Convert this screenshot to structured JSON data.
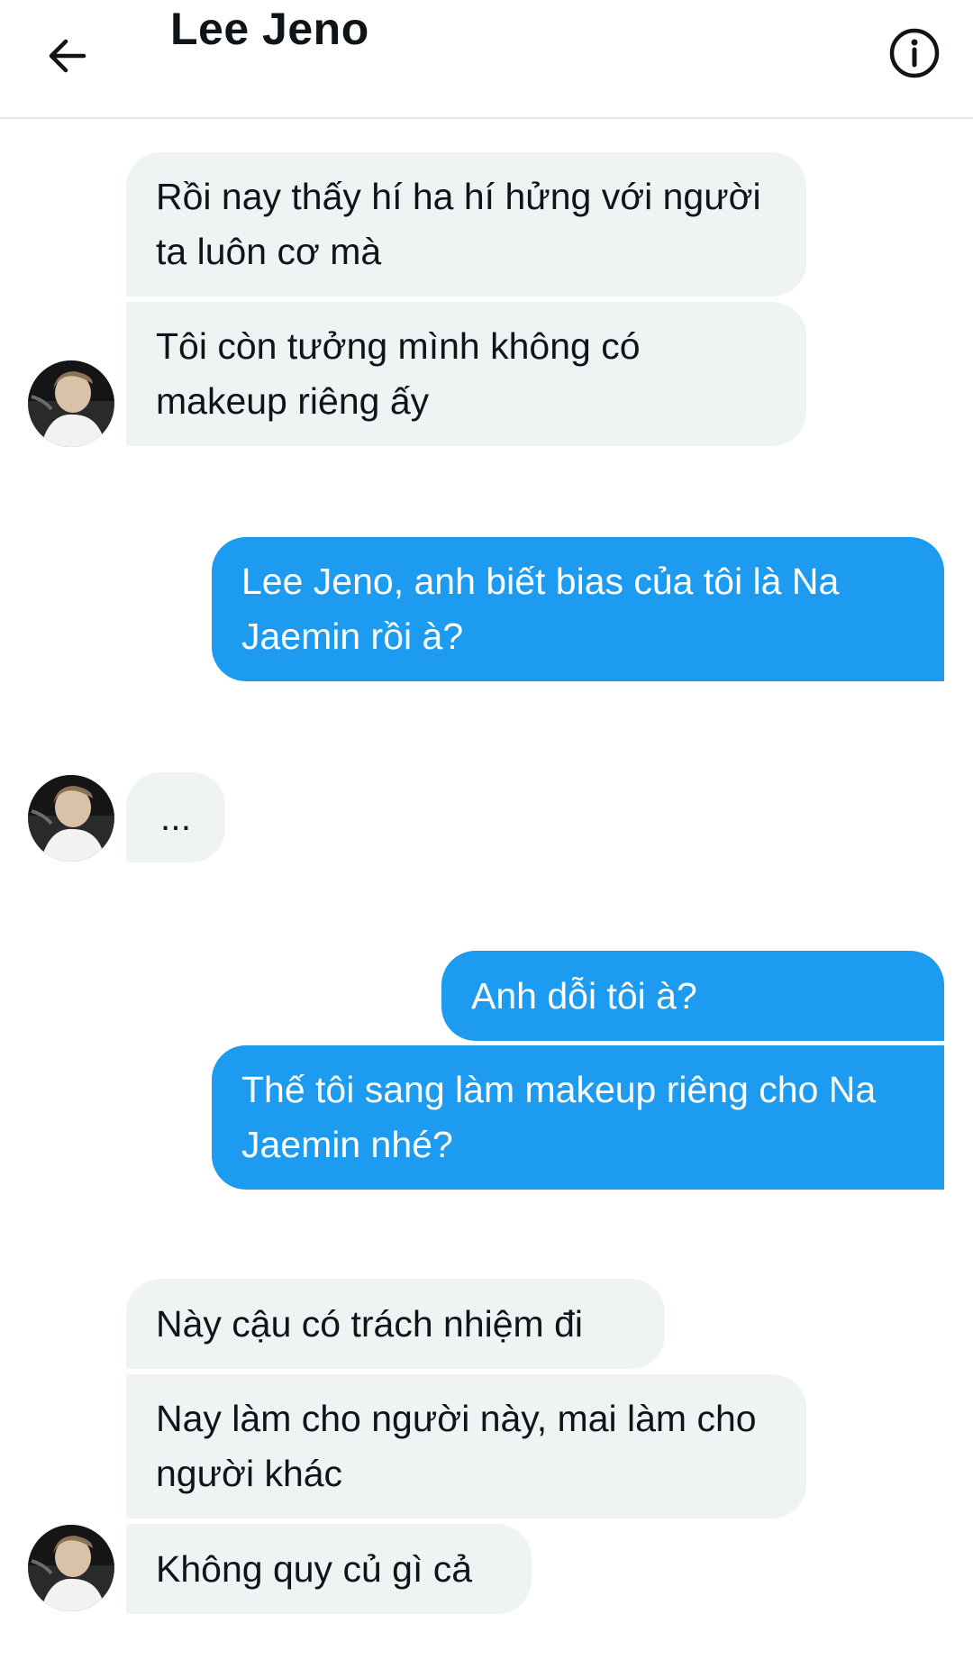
{
  "header": {
    "title": "Lee Jeno",
    "back_icon": "arrow-left-icon",
    "info_icon": "info-circle-icon"
  },
  "messages": [
    {
      "sender": "contact",
      "text": "Rồi nay thấy hí ha hí hửng với người ta luôn cơ mà"
    },
    {
      "sender": "contact",
      "text": "Tôi còn tưởng mình không có makeup riêng ấy"
    },
    {
      "sender": "me",
      "text": "Lee Jeno, anh biết bias của tôi là Na Jaemin rồi à?"
    },
    {
      "sender": "contact",
      "text": "..."
    },
    {
      "sender": "me",
      "text": "Anh dỗi tôi à?"
    },
    {
      "sender": "me",
      "text": "Thế tôi sang làm makeup riêng cho Na Jaemin nhé?"
    },
    {
      "sender": "contact",
      "text": "Này cậu có trách nhiệm đi"
    },
    {
      "sender": "contact",
      "text": "Nay làm cho người này, mai làm cho người khác"
    },
    {
      "sender": "contact",
      "text": "Không quy củ gì cả"
    }
  ],
  "colors": {
    "incoming_bubble": "#eff3f4",
    "outgoing_bubble": "#1d9bf0",
    "outgoing_text": "#ffffff"
  }
}
